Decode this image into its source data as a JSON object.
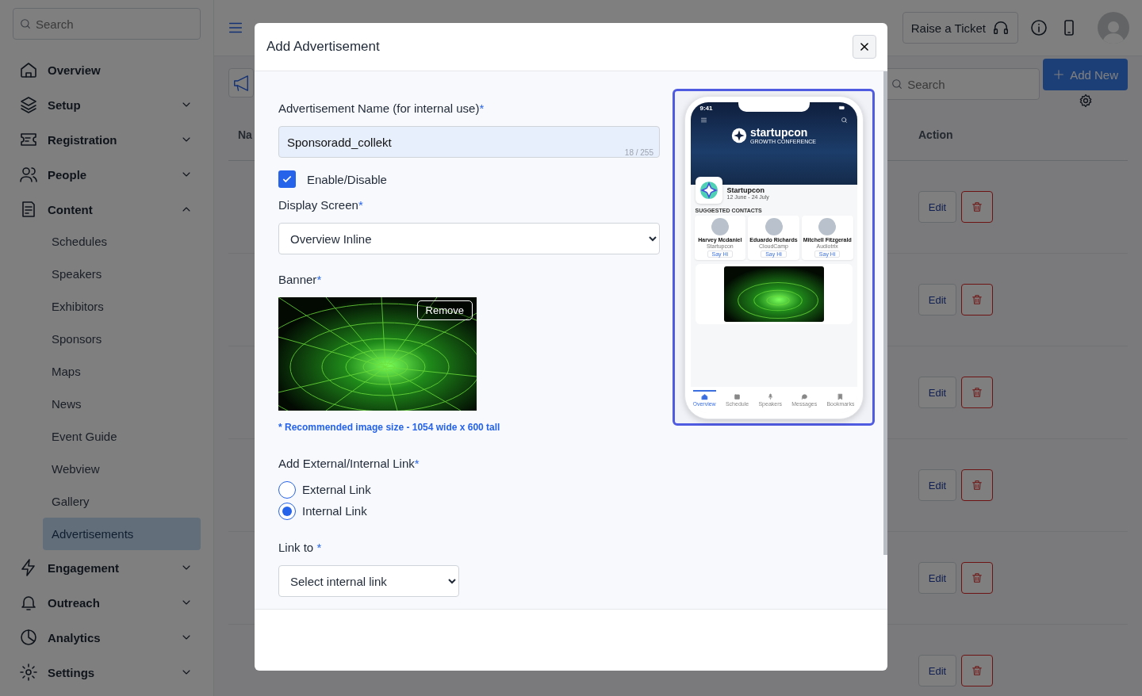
{
  "sidebar": {
    "search": {
      "placeholder": "Search"
    },
    "items": [
      {
        "label": "Overview",
        "kind": "link"
      },
      {
        "label": "Setup",
        "kind": "group",
        "expanded": false
      },
      {
        "label": "Registration",
        "kind": "group",
        "expanded": false
      },
      {
        "label": "People",
        "kind": "group",
        "expanded": false
      },
      {
        "label": "Content",
        "kind": "group",
        "expanded": true,
        "children": [
          {
            "label": "Schedules",
            "selected": false
          },
          {
            "label": "Speakers",
            "selected": false
          },
          {
            "label": "Exhibitors",
            "selected": false
          },
          {
            "label": "Sponsors",
            "selected": false
          },
          {
            "label": "Maps",
            "selected": false
          },
          {
            "label": "News",
            "selected": false
          },
          {
            "label": "Event Guide",
            "selected": false
          },
          {
            "label": "Webview",
            "selected": false
          },
          {
            "label": "Gallery",
            "selected": false
          },
          {
            "label": "Advertisements",
            "selected": true
          }
        ]
      },
      {
        "label": "Engagement",
        "kind": "group",
        "expanded": false
      },
      {
        "label": "Outreach",
        "kind": "group",
        "expanded": false
      },
      {
        "label": "Analytics",
        "kind": "group",
        "expanded": false
      },
      {
        "label": "Settings",
        "kind": "group",
        "expanded": false
      }
    ]
  },
  "header": {
    "ticket_button": "Raise a Ticket"
  },
  "toolbar": {
    "search": {
      "placeholder": "Search"
    },
    "add_button": "Add New"
  },
  "table": {
    "columns": [
      "Na",
      "Action"
    ],
    "rows": [
      {
        "edit": "Edit"
      },
      {
        "edit": "Edit"
      },
      {
        "edit": "Edit"
      },
      {
        "edit": "Edit"
      },
      {
        "edit": "Edit"
      },
      {
        "edit": "Edit"
      }
    ]
  },
  "modal": {
    "title": "Add Advertisement",
    "name_field": {
      "label": "Advertisement Name (for internal use)",
      "required_mark": "*",
      "value": "Sponsoradd_collekt",
      "counter": "18 / 255"
    },
    "enable": {
      "label": "Enable/Disable",
      "checked": true
    },
    "display_screen": {
      "label": "Display Screen",
      "required_mark": "*",
      "value": "Overview Inline"
    },
    "banner": {
      "label": "Banner",
      "required_mark": "*",
      "remove_button": "Remove",
      "hint": "* Recommended image size - 1054 wide x 600 tall"
    },
    "link_type": {
      "label": "Add External/Internal Link",
      "required_mark": "*",
      "options": [
        {
          "label": "External Link",
          "selected": false
        },
        {
          "label": "Internal Link",
          "selected": true
        }
      ]
    },
    "link_to": {
      "label": "Link to ",
      "required_mark": "*",
      "value": "Select internal link"
    },
    "preview": {
      "time": "9:41",
      "brand": "startupcon",
      "tagline": "GROWTH CONFERENCE",
      "event_name": "Startupcon",
      "event_dates": "12 June - 24 July",
      "section_title": "SUGGESTED CONTACTS",
      "contacts": [
        {
          "name": "Harvey Mcdaniel",
          "company": "Startupcon",
          "action": "Say Hi"
        },
        {
          "name": "Eduardo Richards",
          "company": "CloudCamp",
          "action": "Say Hi"
        },
        {
          "name": "Mitchell Fitzgerald",
          "company": "Audiotrix",
          "action": "Say Hi"
        }
      ],
      "tabs": [
        {
          "label": "Overview",
          "selected": true
        },
        {
          "label": "Schedule",
          "selected": false
        },
        {
          "label": "Speakers",
          "selected": false
        },
        {
          "label": "Messages",
          "selected": false
        },
        {
          "label": "Bookmarks",
          "selected": false
        }
      ]
    }
  }
}
